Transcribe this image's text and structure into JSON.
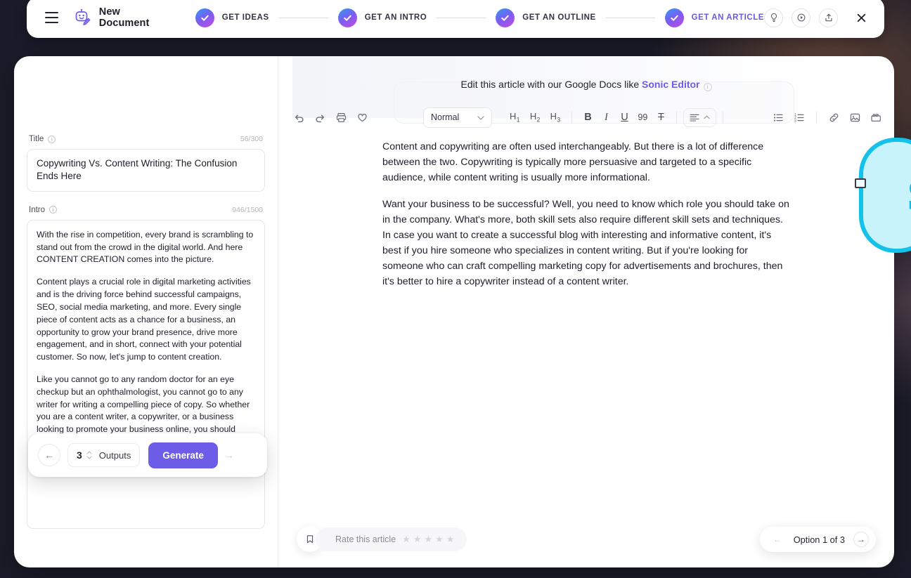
{
  "topbar": {
    "menu_icon": "hamburger-icon",
    "doc_icon": "robot-pen-icon",
    "doc_title": "New Document",
    "steps": [
      {
        "label": "GET IDEAS",
        "state": "done"
      },
      {
        "label": "GET AN INTRO",
        "state": "done"
      },
      {
        "label": "GET AN OUTLINE",
        "state": "done"
      },
      {
        "label": "GET AN ARTICLE",
        "state": "current"
      }
    ],
    "actions": [
      {
        "icon": "lightbulb-icon",
        "name": "tips-button"
      },
      {
        "icon": "play-circle-icon",
        "name": "tutorial-button"
      },
      {
        "icon": "share-upload-icon",
        "name": "share-button"
      }
    ],
    "close_label": "✕"
  },
  "left_panel": {
    "title_field": {
      "label": "Title",
      "counter": "56/300",
      "value": "Copywriting Vs. Content Writing: The Confusion Ends Here"
    },
    "intro_field": {
      "label": "Intro",
      "counter": "946/1500",
      "paragraphs": [
        "With the rise in competition, every brand is scrambling to stand out from the crowd in the digital world. And here CONTENT CREATION comes into the picture.",
        "Content plays a crucial role in digital marketing activities and is the driving force behind successful campaigns, SEO, social media marketing, and more. Every single piece of content acts as a chance for a business, an opportunity to grow your brand presence, drive more engagement, and in short, connect with your potential customer. So now, let's jump to content creation.",
        "Like you cannot go to any random doctor for an eye checkup but an ophthalmologist, you cannot go to any writer for writing a compelling piece of copy. So whether you are a content writer, a copywriter, or a business looking to promote your business online, you should learn the nuances that distinguish content writing from copywriting."
      ]
    },
    "generate_bar": {
      "prev_label": "←",
      "count": "3",
      "outputs_label": "Outputs",
      "generate_label": "Generate",
      "next_label": "→"
    }
  },
  "editor": {
    "banner_prefix": "Edit this article with our Google Docs like ",
    "banner_accent": "Sonic Editor",
    "toolbar": {
      "undo": "undo-icon",
      "redo": "redo-icon",
      "print": "print-icon",
      "favorite": "heart-icon",
      "style_value": "Normal",
      "headings": [
        "H1",
        "H2",
        "H3"
      ],
      "bold": "B",
      "italic": "I",
      "underline": "U",
      "quote": "99",
      "clear_format": "T",
      "align": "align-left-icon",
      "bullet_list": "bullet-list-icon",
      "numbered_list": "numbered-list-icon",
      "link": "link-icon",
      "image": "image-icon",
      "video": "video-icon"
    },
    "article_paragraphs": [
      "Content and copywriting are often used interchangeably. But there is a lot of difference between the two. Copywriting is typically more persuasive and targeted to a specific audience, while content writing is usually more informational.",
      "Want your business to be successful? Well, you need to know which role you should take on in the company. What's more, both skill sets also require different skill sets and techniques. In case you want to create a successful blog with interesting and informative content, it's best if you hire someone who specializes in content writing. But if you're looking for someone who can craft compelling marketing copy for advertisements and brochures, then it's better to hire a copywriter instead of a content writer."
    ],
    "footer": {
      "bookmark_icon": "bookmark-icon",
      "rate_label": "Rate this article",
      "stars": [
        "★",
        "★",
        "★",
        "★",
        "★"
      ],
      "pager_prev": "←",
      "pager_label": "Option 1 of 3",
      "pager_next": "→"
    }
  },
  "sticker": {
    "letter": "S"
  },
  "colors": {
    "accent_purple": "#6c5ce7",
    "step_gradient_start": "#2e9df4",
    "step_gradient_end": "#c44ce0",
    "sticker_cyan": "#12c2e9",
    "background": "#1a1b28"
  }
}
